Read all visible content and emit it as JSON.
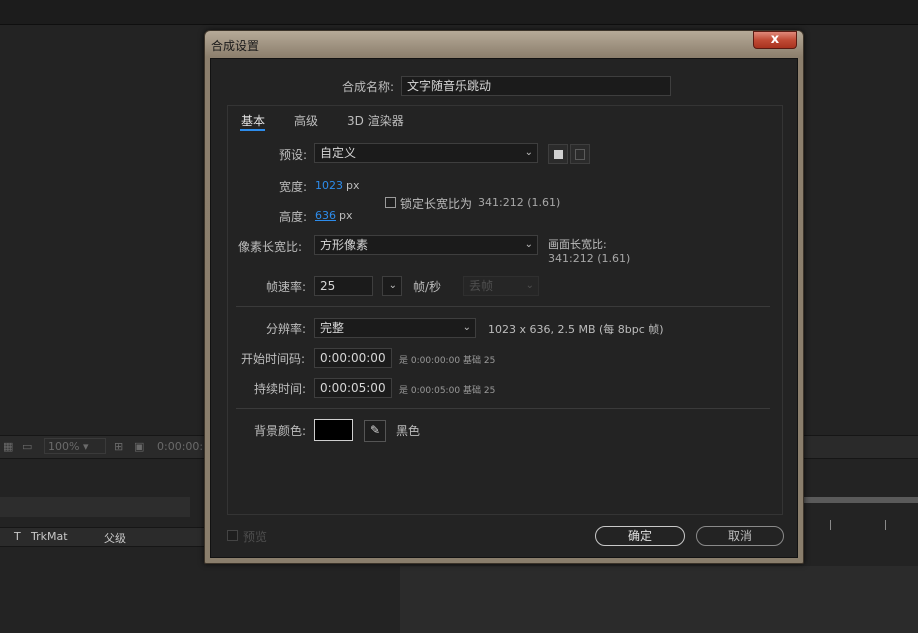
{
  "background": {
    "zoom": "100%",
    "timecode": "0:00:00:",
    "layer_header": {
      "t": "T",
      "trkmat": "TrkMat",
      "parent": "父级"
    }
  },
  "dialog": {
    "title": "合成设置",
    "close": "x",
    "comp_name_label": "合成名称:",
    "comp_name_value": "文字随音乐跳动",
    "tabs": [
      "基本",
      "高级",
      "3D 渲染器"
    ],
    "preset_label": "预设:",
    "preset_value": "自定义",
    "width_label": "宽度:",
    "width_value": "1023",
    "width_unit": "px",
    "height_label": "高度:",
    "height_value": "636",
    "height_unit": "px",
    "lock_aspect_label": "锁定长宽比为",
    "lock_aspect_value": "341:212 (1.61)",
    "pixel_aspect_label": "像素长宽比:",
    "pixel_aspect_value": "方形像素",
    "frame_aspect_label": "画面长宽比:",
    "frame_aspect_value": "341:212 (1.61)",
    "fps_label": "帧速率:",
    "fps_value": "25",
    "fps_unit": "帧/秒",
    "drop_frame_value": "丢帧",
    "resolution_label": "分辨率:",
    "resolution_value": "完整",
    "resolution_info": "1023 x 636, 2.5 MB (每 8bpc 帧)",
    "start_tc_label": "开始时间码:",
    "start_tc_value": "0:00:00:00",
    "start_tc_note": "是 0:00:00:00",
    "start_tc_base": "基础 25",
    "duration_label": "持续时间:",
    "duration_value": "0:00:05:00",
    "duration_note": "是 0:00:05:00",
    "duration_base": "基础 25",
    "bg_color_label": "背景颜色:",
    "bg_color_name": "黑色",
    "bg_color_hex": "#000000",
    "preview_label": "预览",
    "ok_label": "确定",
    "cancel_label": "取消"
  }
}
